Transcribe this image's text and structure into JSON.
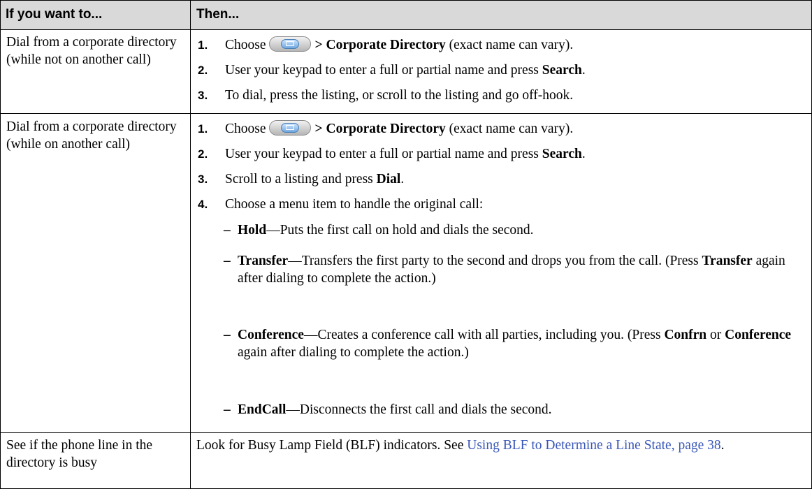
{
  "header": {
    "col1": "If you want to...",
    "col2": "Then..."
  },
  "rows": [
    {
      "task": "Dial from a corporate directory (while not on another call)",
      "steps": [
        {
          "num": "1.",
          "pre": "Choose",
          "bold": "> Corporate Directory",
          "post": " (exact name can vary)."
        },
        {
          "num": "2.",
          "pre": "User your keypad to enter a full or partial name and press ",
          "bold": "Search",
          "post": "."
        },
        {
          "num": "3.",
          "text": "To dial, press the listing, or scroll to the listing and go off-hook."
        }
      ]
    },
    {
      "task": "Dial from a corporate directory (while on another call)",
      "steps": [
        {
          "num": "1.",
          "pre": "Choose",
          "bold": "> Corporate Directory",
          "post": " (exact name can vary)."
        },
        {
          "num": "2.",
          "pre": "User your keypad to enter a full or partial name and press ",
          "bold": "Search",
          "post": "."
        },
        {
          "num": "3.",
          "pre": "Scroll to a listing and press ",
          "bold": "Dial",
          "post": "."
        },
        {
          "num": "4.",
          "text": "Choose a menu item to handle the original call:"
        }
      ],
      "options": [
        {
          "dash": "–",
          "term": "Hold",
          "desc": "—Puts the first call on hold and dials the second."
        },
        {
          "dash": "–",
          "term": "Transfer",
          "desc": "—Transfers the first party to the second and drops you from the call. (Press ",
          "b2": "Transfer",
          "desc2": " again after dialing to complete the action.)"
        },
        {
          "dash": "–",
          "term": "Conference",
          "desc": "—Creates a conference call with all parties, including you. (Press ",
          "b2": "Confrn",
          "mid": " or ",
          "b3": "Conference",
          "desc2": " again after dialing to complete the action.)"
        },
        {
          "dash": "–",
          "term": "EndCall",
          "desc": "—Disconnects the first call and dials the second."
        }
      ]
    },
    {
      "task": "See if the phone line in the directory is busy",
      "text_pre": "Look for Busy Lamp Field (BLF) indicators. See ",
      "link": "Using BLF to Determine a Line State, page 38",
      "text_post": "."
    }
  ],
  "icons": {
    "directory_button": "directory-book-icon"
  }
}
